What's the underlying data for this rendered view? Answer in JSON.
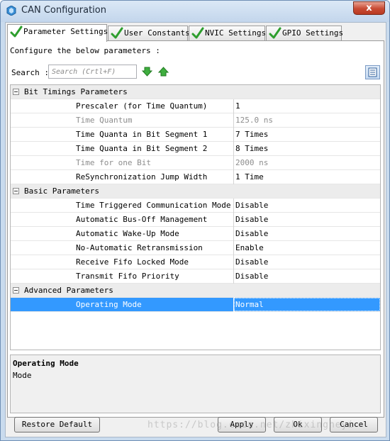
{
  "window": {
    "title": "CAN Configuration",
    "close_label": "x"
  },
  "tabs": [
    {
      "label": "Parameter Settings",
      "icon": "check-icon",
      "active": true
    },
    {
      "label": "User Constants",
      "icon": "check-icon",
      "active": false
    },
    {
      "label": "NVIC Settings",
      "icon": "check-icon",
      "active": false
    },
    {
      "label": "GPIO Settings",
      "icon": "check-icon",
      "active": false
    }
  ],
  "panel": {
    "configure_label": "Configure the below parameters :",
    "search_label": "Search :",
    "search_placeholder": "Search (Crtl+F)",
    "search_value": ""
  },
  "groups": [
    {
      "label": "Bit Timings Parameters",
      "rows": [
        {
          "name": "Prescaler (for Time Quantum)",
          "value": "1",
          "enabled": true
        },
        {
          "name": "Time Quantum",
          "value": "125.0 ns",
          "enabled": false
        },
        {
          "name": "Time Quanta in Bit Segment 1",
          "value": "7 Times",
          "enabled": true
        },
        {
          "name": "Time Quanta in Bit Segment 2",
          "value": "8 Times",
          "enabled": true
        },
        {
          "name": "Time for one Bit",
          "value": "2000 ns",
          "enabled": false
        },
        {
          "name": "ReSynchronization Jump Width",
          "value": "1 Time",
          "enabled": true
        }
      ]
    },
    {
      "label": "Basic Parameters",
      "rows": [
        {
          "name": "Time Triggered Communication Mode",
          "value": "Disable",
          "enabled": true
        },
        {
          "name": "Automatic Bus-Off Management",
          "value": "Disable",
          "enabled": true
        },
        {
          "name": "Automatic Wake-Up Mode",
          "value": "Disable",
          "enabled": true
        },
        {
          "name": "No-Automatic Retransmission",
          "value": "Enable",
          "enabled": true
        },
        {
          "name": "Receive Fifo Locked Mode",
          "value": "Disable",
          "enabled": true
        },
        {
          "name": "Transmit Fifo Priority",
          "value": "Disable",
          "enabled": true
        }
      ]
    },
    {
      "label": "Advanced Parameters",
      "rows": [
        {
          "name": "Operating Mode",
          "value": "Normal",
          "enabled": true,
          "selected": true
        }
      ]
    }
  ],
  "description": {
    "title": "Operating Mode",
    "text": "Mode"
  },
  "buttons": {
    "restore": "Restore Default",
    "apply": "Apply",
    "ok": "Ok",
    "cancel": "Cancel"
  },
  "watermark": "https://blog.csdn.net/zhixingheyi",
  "colors": {
    "selection": "#3399ff",
    "check": "#2e9e2e",
    "close": "#c84a32"
  }
}
